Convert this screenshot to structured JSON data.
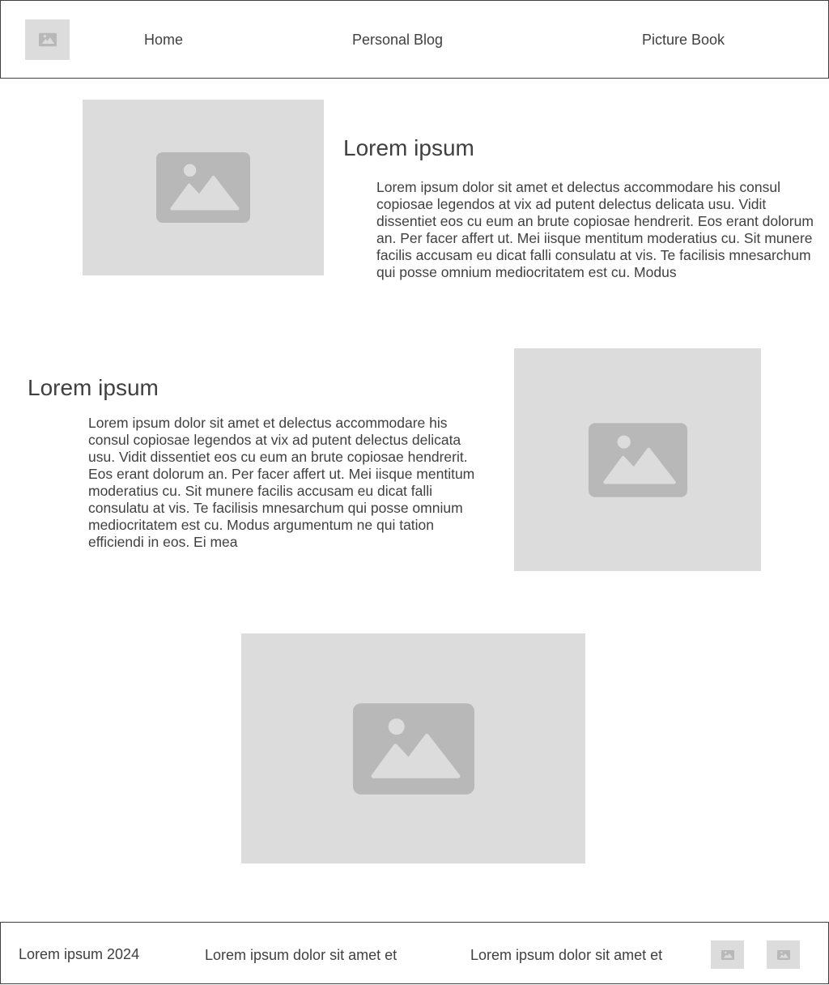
{
  "header": {
    "logo_icon": "image-icon",
    "nav": [
      {
        "label": "Home"
      },
      {
        "label": "Personal Blog"
      },
      {
        "label": "Picture Book"
      }
    ]
  },
  "sections": [
    {
      "image_icon": "image-icon",
      "title": "Lorem ipsum",
      "body": "Lorem ipsum dolor sit amet et delectus accommodare his consul copiosae legendos at vix ad putent delectus delicata usu. Vidit dissentiet eos cu eum an brute copiosae hendrerit. Eos erant dolorum an. Per facer affert ut. Mei iisque mentitum moderatius cu. Sit munere facilis accusam eu dicat falli consulatu at vis. Te facilisis mnesarchum qui posse omnium mediocritatem est cu. Modus"
    },
    {
      "image_icon": "image-icon",
      "title": "Lorem ipsum",
      "body": "Lorem ipsum dolor sit amet et delectus accommodare his consul copiosae legendos at vix ad putent delectus delicata usu. Vidit dissentiet eos cu eum an brute copiosae hendrerit. Eos erant dolorum an. Per facer affert ut. Mei iisque mentitum moderatius cu. Sit munere facilis accusam eu dicat falli consulatu at vis. Te facilisis mnesarchum qui posse omnium mediocritatem est cu. Modus argumentum ne qui tation efficiendi in eos. Ei mea"
    }
  ],
  "feature_image": {
    "icon": "image-icon"
  },
  "footer": {
    "copyright": "Lorem ipsum 2024",
    "link_1": "Lorem ipsum dolor sit amet et",
    "link_2": "Lorem ipsum dolor sit amet et",
    "icons": [
      "image-icon",
      "image-icon"
    ]
  },
  "colors": {
    "text": "#404040",
    "placeholder_bg": "#dcdcdc",
    "placeholder_icon": "#b8b8b8",
    "border": "#404040"
  }
}
